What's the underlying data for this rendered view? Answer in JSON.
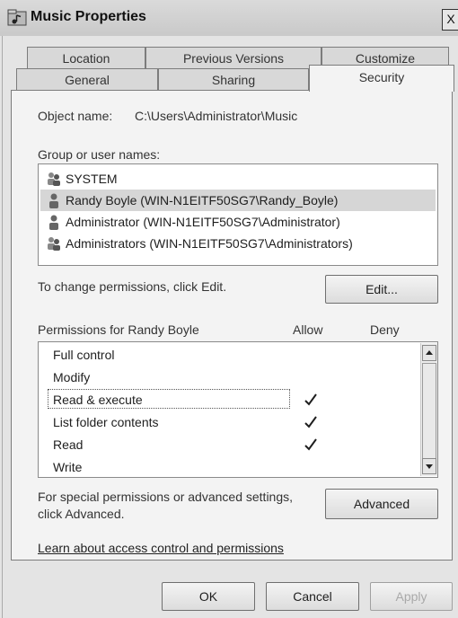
{
  "window": {
    "title": "Music Properties",
    "close_glyph": "X"
  },
  "tabs": {
    "row_back": [
      "Location",
      "Previous Versions",
      "Customize"
    ],
    "row_front": [
      "General",
      "Sharing",
      "Security"
    ],
    "active": "Security"
  },
  "security": {
    "object_name_label": "Object name:",
    "object_name_value": "C:\\Users\\Administrator\\Music",
    "group_label": "Group or user names:",
    "users": [
      {
        "name": "SYSTEM",
        "icon": "group-users-icon",
        "selected": false
      },
      {
        "name": "Randy Boyle (WIN-N1EITF50SG7\\Randy_Boyle)",
        "icon": "user-icon",
        "selected": true
      },
      {
        "name": "Administrator (WIN-N1EITF50SG7\\Administrator)",
        "icon": "user-icon",
        "selected": false
      },
      {
        "name": "Administrators (WIN-N1EITF50SG7\\Administrators)",
        "icon": "group-users-icon",
        "selected": false
      }
    ],
    "change_text": "To change permissions, click Edit.",
    "edit_button": "Edit...",
    "permissions_label": "Permissions for Randy Boyle",
    "allow_header": "Allow",
    "deny_header": "Deny",
    "permissions": [
      {
        "name": "Full control",
        "allow": false,
        "deny": false
      },
      {
        "name": "Modify",
        "allow": false,
        "deny": false
      },
      {
        "name": "Read & execute",
        "allow": true,
        "deny": false
      },
      {
        "name": "List folder contents",
        "allow": true,
        "deny": false
      },
      {
        "name": "Read",
        "allow": true,
        "deny": false
      },
      {
        "name": "Write",
        "allow": false,
        "deny": false
      }
    ],
    "special_text_line1": "For special permissions or advanced settings,",
    "special_text_line2": "click Advanced.",
    "advanced_button": "Advanced",
    "learn_link": "Learn about access control and permissions"
  },
  "footer": {
    "ok": "OK",
    "cancel": "Cancel",
    "apply": "Apply"
  }
}
